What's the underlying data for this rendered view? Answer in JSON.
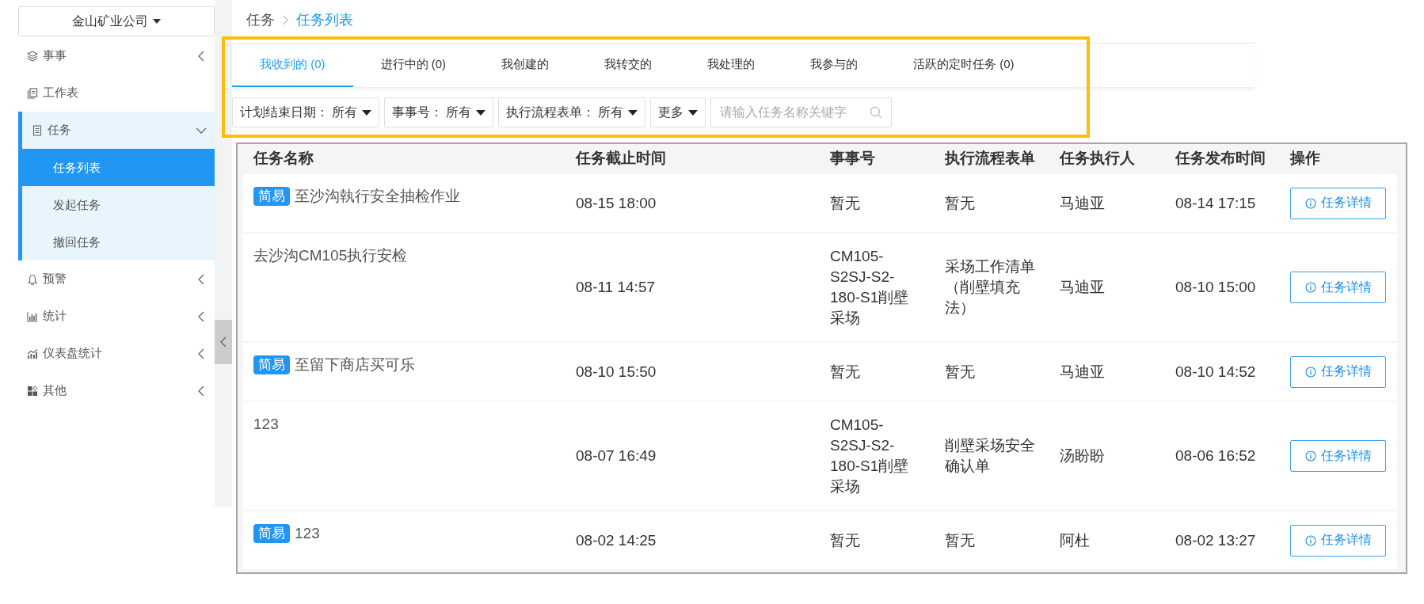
{
  "sidebar": {
    "company": "金山矿业公司",
    "items": [
      {
        "label": "事事",
        "kind": "group",
        "expanded": false
      },
      {
        "label": "工作表",
        "kind": "link"
      },
      {
        "label": "任务",
        "kind": "group",
        "expanded": true,
        "children": [
          {
            "label": "任务列表",
            "selected": true
          },
          {
            "label": "发起任务",
            "selected": false
          },
          {
            "label": "撤回任务",
            "selected": false
          }
        ]
      },
      {
        "label": "预警",
        "kind": "group",
        "expanded": false
      },
      {
        "label": "统计",
        "kind": "group",
        "expanded": false
      },
      {
        "label": "仪表盘统计",
        "kind": "group",
        "expanded": false
      },
      {
        "label": "其他",
        "kind": "group",
        "expanded": false
      }
    ]
  },
  "breadcrumb": [
    {
      "label": "任务",
      "current": false
    },
    {
      "label": "任务列表",
      "current": true
    }
  ],
  "tabs": [
    {
      "label": "我收到的 (0)",
      "selected": true
    },
    {
      "label": "进行中的 (0)",
      "selected": false
    },
    {
      "label": "我创建的",
      "selected": false
    },
    {
      "label": "我转交的",
      "selected": false
    },
    {
      "label": "我处理的",
      "selected": false
    },
    {
      "label": "我参与的",
      "selected": false
    },
    {
      "label": "活跃的定时任务 (0)",
      "selected": false
    }
  ],
  "filters": [
    {
      "label": "计划结束日期：",
      "value": "所有"
    },
    {
      "label": "事事号：",
      "value": "所有"
    },
    {
      "label": "执行流程表单：",
      "value": "所有"
    },
    {
      "label": "更多"
    }
  ],
  "search": {
    "placeholder": "请输入任务名称关键字"
  },
  "table": {
    "columns": [
      "任务名称",
      "任务截止时间",
      "事事号",
      "执行流程表单",
      "任务执行人",
      "任务发布时间",
      "操作"
    ],
    "rows": [
      {
        "tag": "简易",
        "name": "至沙沟執行安全抽检作业",
        "deadline": "08-15 18:00",
        "matter_no": "暂无",
        "form": "暂无",
        "assignee": "马迪亚",
        "published": "08-14 17:15",
        "action": "任务详情"
      },
      {
        "name": "去沙沟CM105执行安检",
        "deadline": "08-11 14:57",
        "matter_no": "CM105-S2SJ-S2-180-S1削壁采场",
        "form": "采场工作清单（削壁填充法）",
        "assignee": "马迪亚",
        "published": "08-10 15:00",
        "action": "任务详情"
      },
      {
        "tag": "简易",
        "name": "至留下商店买可乐",
        "deadline": "08-10 15:50",
        "matter_no": "暂无",
        "form": "暂无",
        "assignee": "马迪亚",
        "published": "08-10 14:52",
        "action": "任务详情"
      },
      {
        "name": "123",
        "deadline": "08-07 16:49",
        "matter_no": "CM105-S2SJ-S2-180-S1削壁采场",
        "form": "削壁采场安全确认单",
        "assignee": "汤盼盼",
        "published": "08-06 16:52",
        "action": "任务详情"
      },
      {
        "tag": "简易",
        "name": "123",
        "deadline": "08-02 14:25",
        "matter_no": "暂无",
        "form": "暂无",
        "assignee": "阿杜",
        "published": "08-02 13:27",
        "action": "任务详情"
      }
    ]
  }
}
